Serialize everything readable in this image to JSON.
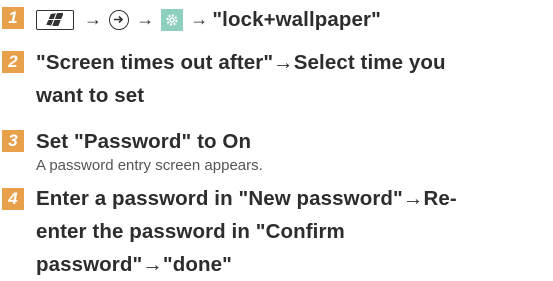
{
  "steps": [
    {
      "number": "1",
      "arrow1": "→",
      "arrow2": "→",
      "arrow3": "→",
      "label": "\"lock+wallpaper\"",
      "icons": [
        "windows-key-icon",
        "circle-arrow-icon",
        "settings-gear-icon"
      ]
    },
    {
      "number": "2",
      "line1": "\"Screen times out after\"→Select time you",
      "line2": "want to set"
    },
    {
      "number": "3",
      "line1": "Set \"Password\" to On",
      "sub": "A password entry screen appears."
    },
    {
      "number": "4",
      "line1": "Enter a password in \"New password\"→Re-",
      "line2": "enter the password in \"Confirm",
      "line3": "password\"→\"done\""
    }
  ],
  "colors": {
    "step_number_bg": "#e8a14a",
    "settings_tile_bg": "#8ecfbe",
    "text": "#2d2d2d"
  }
}
